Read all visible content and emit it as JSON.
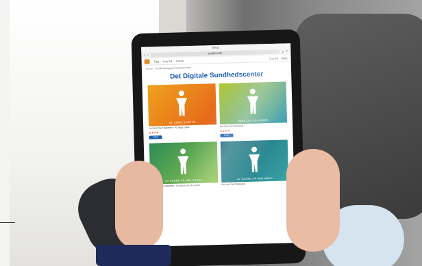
{
  "site": {
    "title": "Det Digitale Sundhedscenter",
    "url": "sundhed.dk",
    "breadcrumb": "Kurser · Sundhedsfaglige/Sundhedscenter"
  },
  "browser": {
    "time": "09:41",
    "nav_items": [
      "Søg",
      "Log ind",
      "Kurser"
    ],
    "right_items": [
      "Log ind",
      "Hjælp"
    ]
  },
  "tiles": [
    {
      "label": "AT SØGE STØTTE",
      "caption": "Lev livet med diabetes - At søge støtte",
      "button": "Start"
    },
    {
      "label": "MINE OPLYSNINGER",
      "caption": "Lev livet med diabetes",
      "button": "Start"
    },
    {
      "label": "AT PASSE PÅ MIN PSYKE",
      "caption": "Lev livet med diabetes - At passe på min psyke",
      "button": ""
    },
    {
      "label": "AT PASSE PÅ MIN KROP",
      "caption": "Lev livet med diabetes",
      "button": ""
    }
  ],
  "colors": {
    "title_blue": "#1b5fb0",
    "tile1": "#f0a21e",
    "tile2": "#3ea1bd",
    "tile3": "#2e8b57",
    "tile4": "#1a6b7a"
  }
}
